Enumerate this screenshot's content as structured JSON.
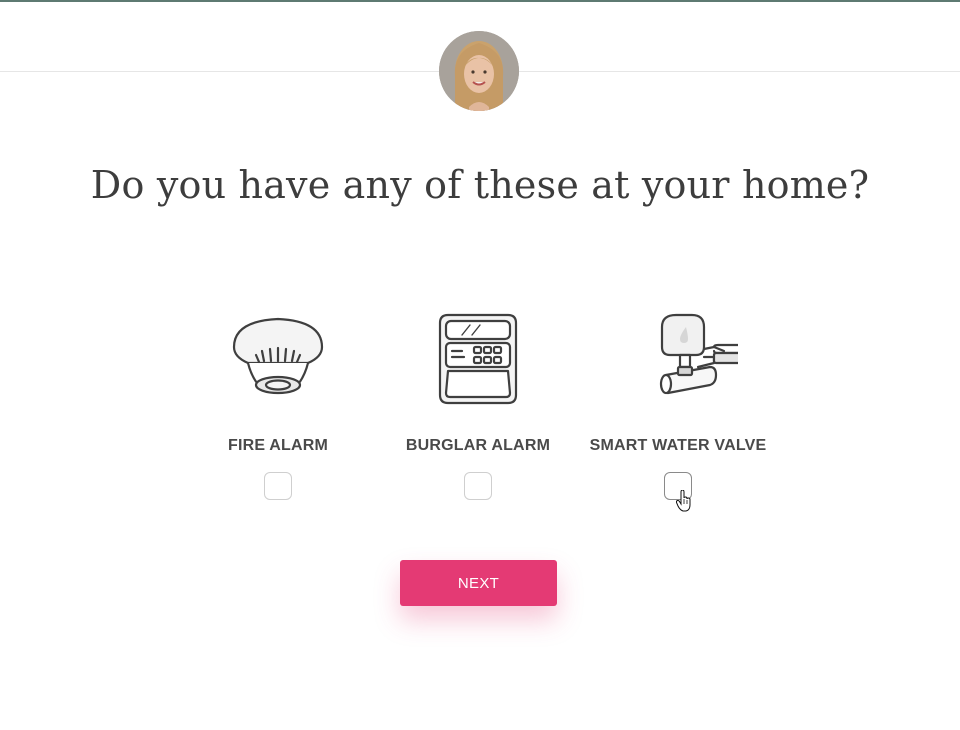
{
  "question": {
    "title": "Do you have any of these at your home?"
  },
  "options": [
    {
      "label": "FIRE ALARM",
      "icon": "fire-alarm-icon",
      "checked": false
    },
    {
      "label": "BURGLAR ALARM",
      "icon": "burglar-alarm-icon",
      "checked": false
    },
    {
      "label": "SMART WATER VALVE",
      "icon": "smart-water-valve-icon",
      "checked": false
    }
  ],
  "actions": {
    "next_label": "NEXT"
  },
  "colors": {
    "accent": "#e43a74",
    "top_border": "#5e7a72",
    "text": "#3d3d3d",
    "icon_stroke": "#3f3f3f"
  }
}
